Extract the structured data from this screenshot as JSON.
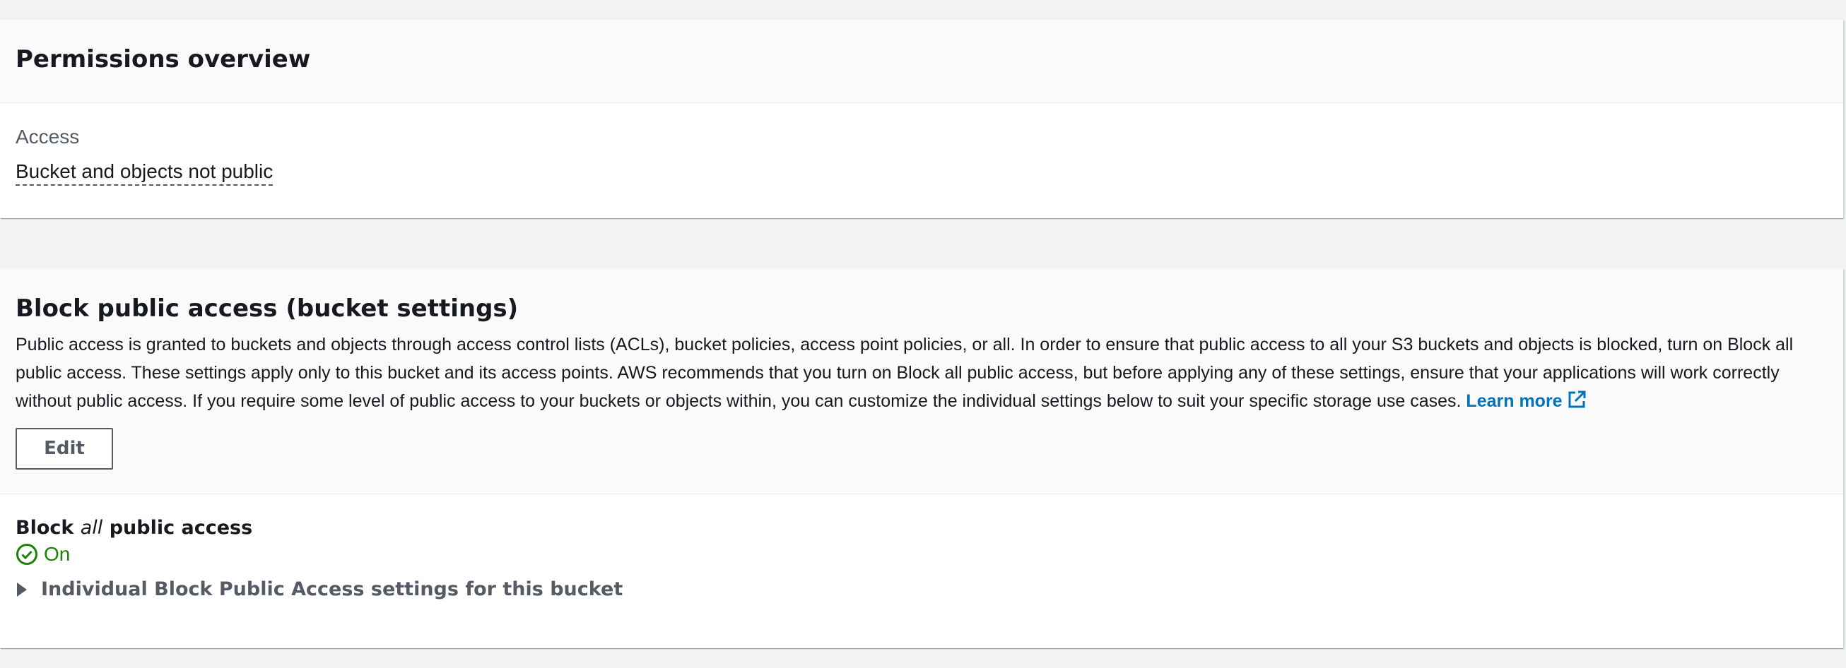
{
  "permissions_overview": {
    "title": "Permissions overview",
    "access_label": "Access",
    "access_value": "Bucket and objects not public"
  },
  "block_public_access": {
    "title": "Block public access (bucket settings)",
    "description": "Public access is granted to buckets and objects through access control lists (ACLs), bucket policies, access point policies, or all. In order to ensure that public access to all your S3 buckets and objects is blocked, turn on Block all public access. These settings apply only to this bucket and its access points. AWS recommends that you turn on Block all public access, but before applying any of these settings, ensure that your applications will work correctly without public access. If you require some level of public access to your buckets or objects within, you can customize the individual settings below to suit your specific storage use cases.",
    "learn_more": "Learn more",
    "edit_label": "Edit",
    "setting_title_prefix": "Block ",
    "setting_title_emphasis": "all",
    "setting_title_suffix": " public access",
    "status": "On",
    "expander_label": "Individual Block Public Access settings for this bucket"
  },
  "icons": {
    "external": "external-link-icon",
    "status": "check-circle-icon",
    "expander": "caret-right-icon"
  },
  "colors": {
    "link": "#0073bb",
    "success": "#1d8102",
    "secondary_text": "#545b64",
    "background": "#f2f3f3"
  }
}
